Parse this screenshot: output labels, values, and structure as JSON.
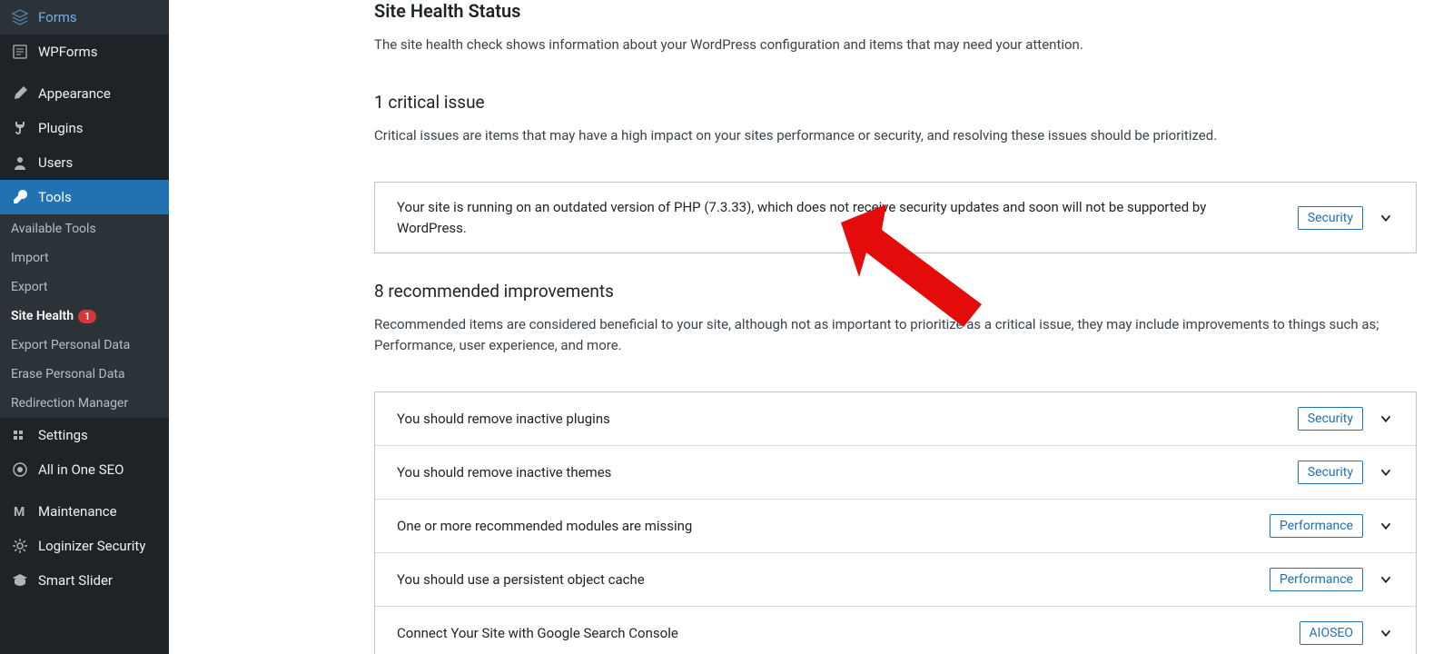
{
  "sidebar": {
    "top_items": [
      {
        "label": "Forms",
        "icon": "forms"
      },
      {
        "label": "WPForms",
        "icon": "wpforms"
      }
    ],
    "mid_items": [
      {
        "label": "Appearance",
        "icon": "brush"
      },
      {
        "label": "Plugins",
        "icon": "plug"
      },
      {
        "label": "Users",
        "icon": "user"
      },
      {
        "label": "Tools",
        "icon": "wrench",
        "active": true
      }
    ],
    "submenu": [
      {
        "label": "Available Tools"
      },
      {
        "label": "Import"
      },
      {
        "label": "Export"
      },
      {
        "label": "Site Health",
        "current": true,
        "badge": "1"
      },
      {
        "label": "Export Personal Data"
      },
      {
        "label": "Erase Personal Data"
      },
      {
        "label": "Redirection Manager"
      }
    ],
    "bottom_items": [
      {
        "label": "Settings",
        "icon": "settings"
      },
      {
        "label": "All in One SEO",
        "icon": "aioseo"
      }
    ],
    "extra_items": [
      {
        "label": "Maintenance",
        "icon": "maint"
      },
      {
        "label": "Loginizer Security",
        "icon": "gear"
      },
      {
        "label": "Smart Slider",
        "icon": "cap"
      }
    ]
  },
  "main": {
    "title": "Site Health Status",
    "desc": "The site health check shows information about your WordPress configuration and items that may need your attention.",
    "critical": {
      "heading": "1 critical issue",
      "desc": "Critical issues are items that may have a high impact on your sites performance or security, and resolving these issues should be prioritized.",
      "items": [
        {
          "text": "Your site is running on an outdated version of PHP (7.3.33), which does not receive security updates and soon will not be supported by WordPress.",
          "tag": "Security"
        }
      ]
    },
    "recommended": {
      "heading": "8 recommended improvements",
      "desc": "Recommended items are considered beneficial to your site, although not as important to prioritize as a critical issue, they may include improvements to things such as; Performance, user experience, and more.",
      "items": [
        {
          "text": "You should remove inactive plugins",
          "tag": "Security"
        },
        {
          "text": "You should remove inactive themes",
          "tag": "Security"
        },
        {
          "text": "One or more recommended modules are missing",
          "tag": "Performance"
        },
        {
          "text": "You should use a persistent object cache",
          "tag": "Performance"
        },
        {
          "text": "Connect Your Site with Google Search Console",
          "tag": "AIOSEO"
        }
      ]
    }
  }
}
